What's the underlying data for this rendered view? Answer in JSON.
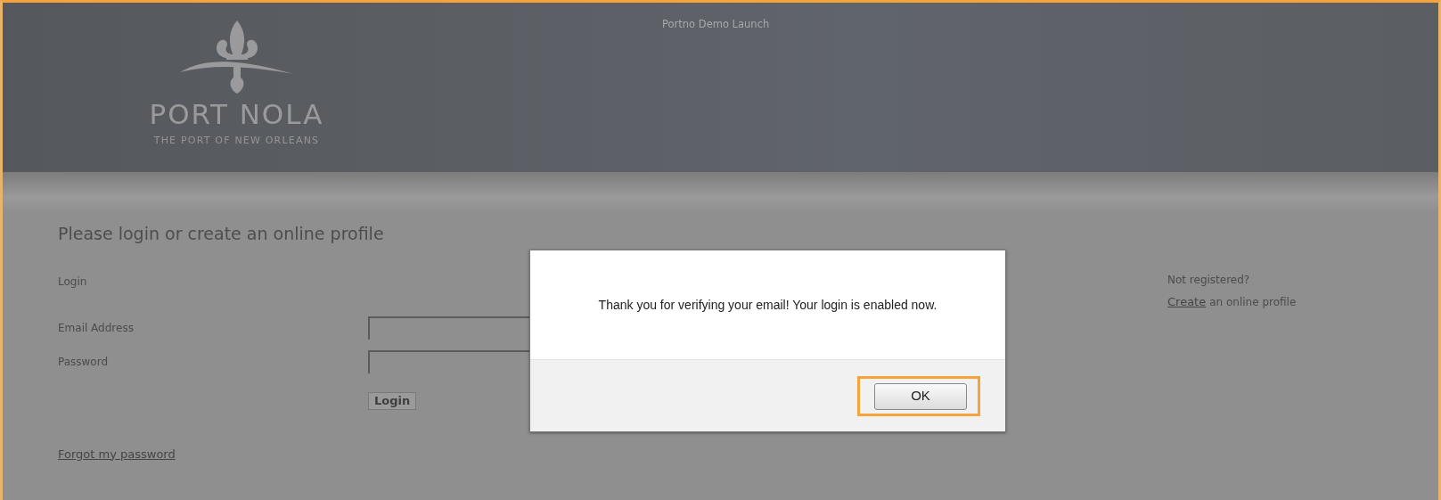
{
  "header": {
    "logo_title": "PORT NOLA",
    "logo_subtitle": "THE PORT OF NEW ORLEANS",
    "top_link": "Portno Demo Launch"
  },
  "login": {
    "heading": "Please login or create an online profile",
    "section_label": "Login",
    "fields": [
      {
        "label": "Email Address"
      },
      {
        "label": "Password"
      }
    ],
    "submit": "Login",
    "forgot_link": "Forgot my password"
  },
  "register": {
    "question": "Not registered?",
    "link": "Create",
    "text": "an online profile"
  },
  "dialog": {
    "message": "Thank you for verifying your email!  Your login is enabled now.",
    "ok_button": "OK",
    "ok_highlighted": true
  }
}
